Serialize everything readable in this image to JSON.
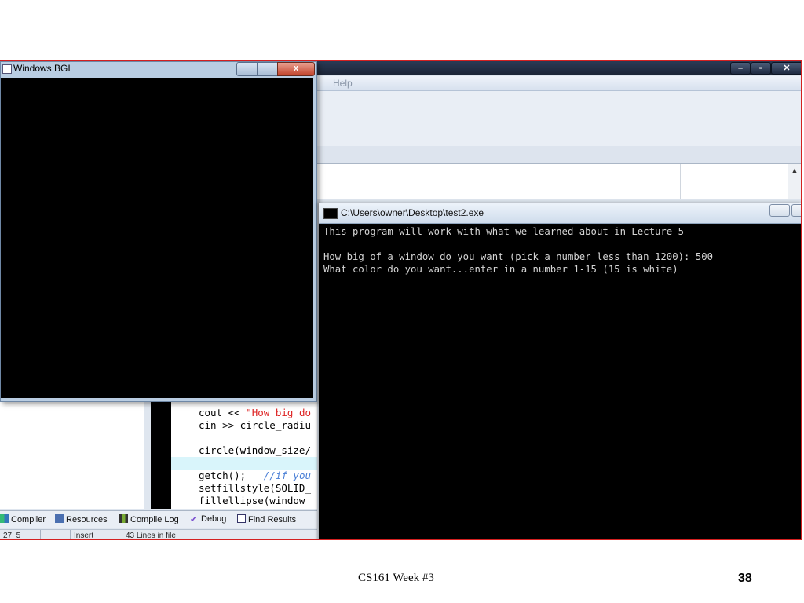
{
  "bgi_window": {
    "title": "Windows BGI",
    "close_label": "x"
  },
  "ide": {
    "menu_help": "Help",
    "scroll_up": "▲",
    "code_lines": [
      {
        "pre": "cout << ",
        "str": "\"How big do",
        "post": ""
      },
      {
        "pre": "cin >> circle_radiu",
        "str": "",
        "post": ""
      },
      {
        "pre": "circle(window_size/",
        "str": "",
        "post": ""
      },
      {
        "pre": "getch();   ",
        "cmt": "//if you"
      },
      {
        "pre": "setfillstyle(SOLID_",
        "str": "",
        "post": ""
      },
      {
        "pre": "fillellipse(window_",
        "str": "",
        "post": ""
      }
    ],
    "tabs": [
      "Compiler",
      "Resources",
      "Compile Log",
      "Debug",
      "Find Results"
    ],
    "status": {
      "position": "27: 5",
      "mode": "Insert",
      "lines": "43 Lines in file"
    }
  },
  "console": {
    "title": "C:\\Users\\owner\\Desktop\\test2.exe",
    "lines": [
      "This program will work with what we learned about in Lecture 5",
      "How big of a window do you want (pick a number less than 1200): 500",
      "What color do you want...enter in a number 1-15 (15 is white)"
    ]
  },
  "slide_footer": {
    "title": "CS161 Week #3",
    "page": "38"
  },
  "colors": {
    "frame_border": "#d42020",
    "console_bg": "#000000",
    "console_text": "#d4d4d4"
  }
}
